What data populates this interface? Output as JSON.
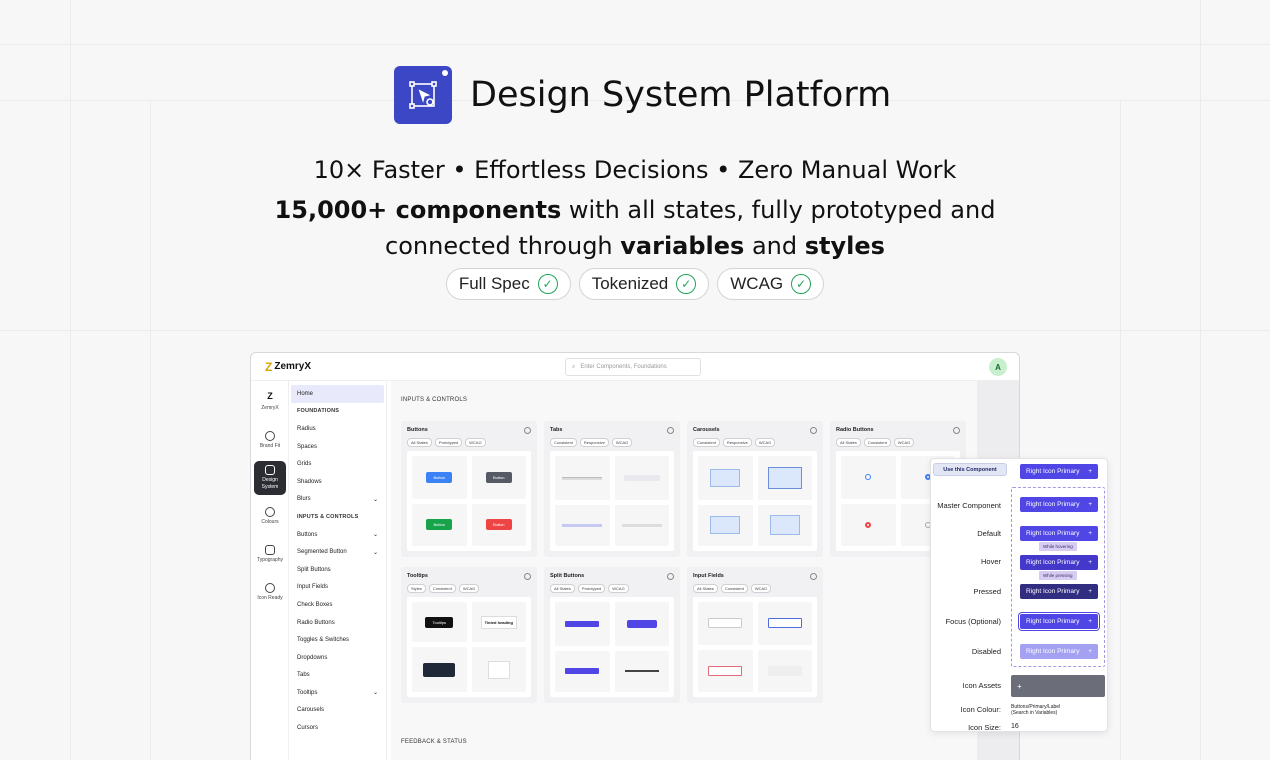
{
  "hero": {
    "title": "Design System Platform",
    "tagline": "10× Faster • Effortless Decisions • Zero Manual Work",
    "line2_a": "15,000+ components",
    "line2_b": " with all states, fully prototyped and",
    "line3_a": "connected through ",
    "line3_b": "variables",
    "line3_c": " and ",
    "line3_d": "styles",
    "pills": [
      "Full Spec",
      "Tokenized",
      "WCAG"
    ]
  },
  "colors": {
    "accent": "#3b47c4",
    "button_primary": "#4f46e5",
    "check_green": "#22a35a"
  },
  "app": {
    "brand": "ZemryX",
    "search_placeholder": "Enter Components, Foundations",
    "avatar": "A",
    "rail": [
      {
        "label": "ZemryX",
        "icon": "zemryx-logo-icon"
      },
      {
        "label": "Brand Fit",
        "icon": "brand-icon"
      },
      {
        "label": "Design System",
        "icon": "design-system-icon"
      },
      {
        "label": "Colours",
        "icon": "palette-icon"
      },
      {
        "label": "Typography",
        "icon": "typography-icon"
      },
      {
        "label": "Icon Ready",
        "icon": "icon-ready-icon"
      }
    ],
    "nav": {
      "home": "Home",
      "foundations": "FOUNDATIONS",
      "foundation_items": [
        "Radius",
        "Spaces",
        "Grids",
        "Shadows",
        "Blurs"
      ],
      "inputs": "INPUTS & CONTROLS",
      "input_items": [
        "Buttons",
        "Segmented Button",
        "Split Buttons",
        "Input Fields",
        "Check Boxes",
        "Radio Buttons",
        "Toggles & Switches",
        "Dropdowns",
        "Tabs",
        "Tooltips",
        "Carousels",
        "Cursors"
      ]
    },
    "main": {
      "section1": "INPUTS & CONTROLS",
      "section2": "FEEDBACK & STATUS",
      "cards": [
        {
          "title": "Buttons",
          "chips": [
            "All States",
            "Prototyped",
            "WCAG"
          ]
        },
        {
          "title": "Tabs",
          "chips": [
            "Consistent",
            "Responsive",
            "WCAG"
          ]
        },
        {
          "title": "Carousels",
          "chips": [
            "Consistent",
            "Responsive",
            "WCAG"
          ]
        },
        {
          "title": "Radio Buttons",
          "chips": [
            "All States",
            "Consistent",
            "WCAG"
          ]
        },
        {
          "title": "Tooltips",
          "chips": [
            "Styles",
            "Consistent",
            "WCAG"
          ]
        },
        {
          "title": "Split Buttons",
          "chips": [
            "All States",
            "Prototyped",
            "WCAG"
          ]
        },
        {
          "title": "Input Fields",
          "chips": [
            "All States",
            "Consistent",
            "WCAG"
          ]
        }
      ],
      "mini_button": "Button",
      "tooltip_label": "Tooltips",
      "tooltip_heading": "Tinted heading"
    }
  },
  "panel": {
    "use_component": "Use this Component",
    "button_label": "Right Icon Primary",
    "plus": "+",
    "labels": [
      "Master Component",
      "Default",
      "Hover",
      "Pressed",
      "Focus (Optional)",
      "Disabled"
    ],
    "tip_hover": "While hovering",
    "tip_pressed": "While pressing",
    "icon_assets": "Icon Assets",
    "icon_colour_label": "Icon Colour:",
    "icon_colour_value_1": "Buttons/Primary/Label",
    "icon_colour_value_2": "(Search in Variables)",
    "icon_size_label": "Icon Size:",
    "icon_size_value": "16"
  }
}
